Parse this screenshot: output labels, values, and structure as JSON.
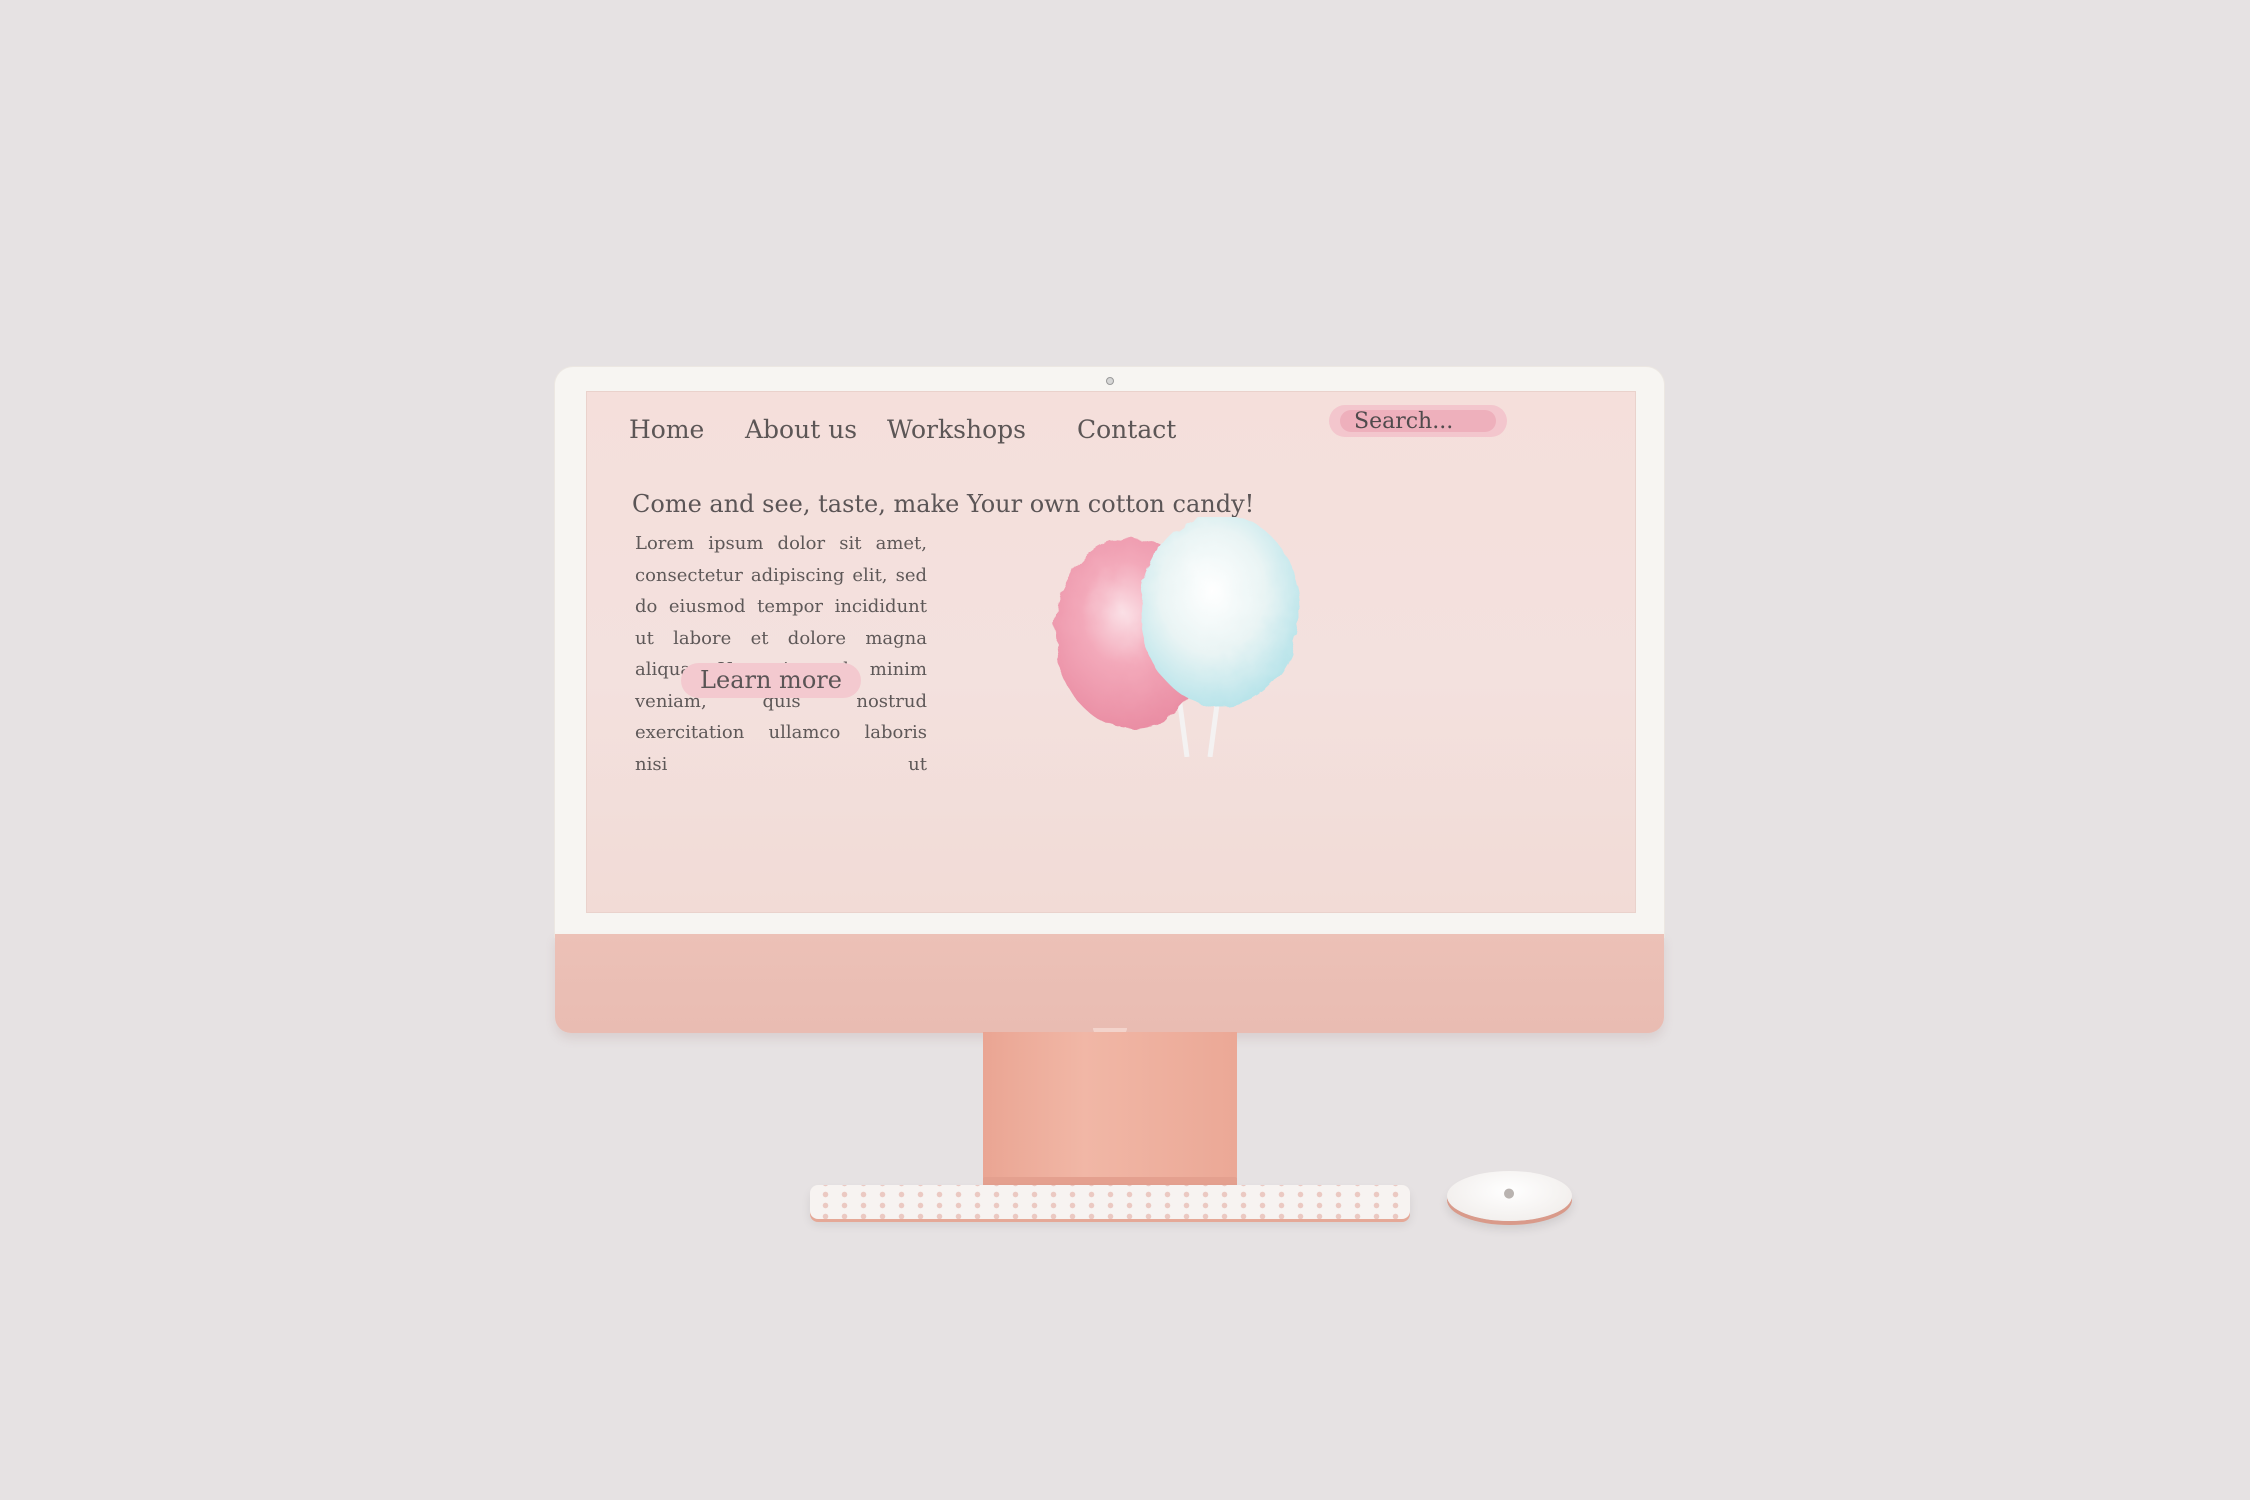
{
  "nav": {
    "items": [
      {
        "label": "Home"
      },
      {
        "label": "About us"
      },
      {
        "label": "Workshops"
      },
      {
        "label": "Contact"
      }
    ]
  },
  "search": {
    "placeholder": "Search..."
  },
  "hero": {
    "headline": "Come and see, taste, make Your own cotton candy!",
    "body": "Lorem ipsum dolor sit amet, consectetur adipiscing elit, sed do eiusmod tempor incididunt ut labore et dolore magna aliqua. Ut enim ad minim veniam, quis nostrud exercitation ullamco laboris nisi ut",
    "cta_label": "Learn more",
    "image": "cotton-candy-illustration"
  },
  "colors": {
    "page_bg": "#e6e2e3",
    "screen_bg": "#f4e0dc",
    "accent_pink": "#f3c9cf",
    "search_pill": "#eeb0bc",
    "device_body": "#ecc1b7",
    "text": "#5b5556",
    "candy_pink": "#ef9fb1",
    "candy_blue": "#dff2f3"
  }
}
